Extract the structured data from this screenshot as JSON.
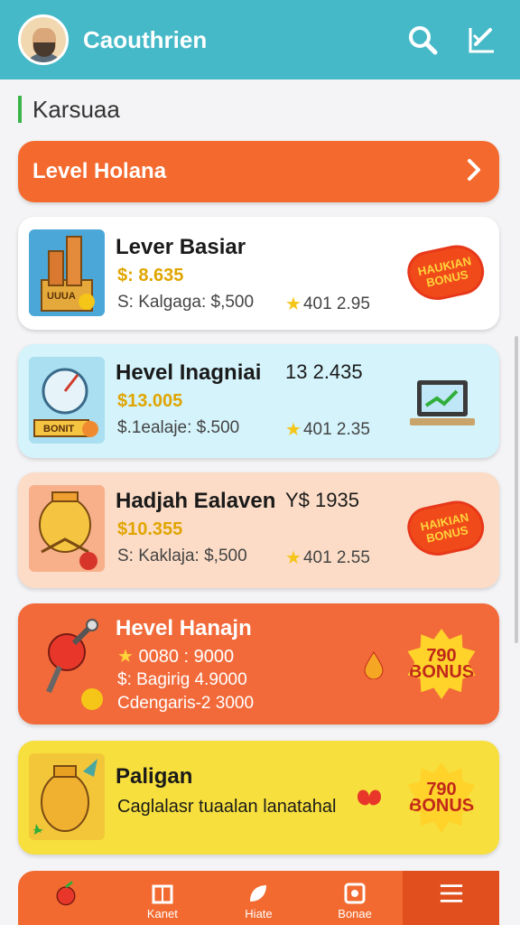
{
  "header": {
    "app_title": "Caouthrien"
  },
  "section": {
    "label": "Karsuaa"
  },
  "level_banner": {
    "label": "Level Holana"
  },
  "cards": [
    {
      "title": "Lever Basiar",
      "title_extra": "",
      "price": "$: 8.635",
      "sub": "S: Kalgaga: $,500",
      "rating": "401 2.95",
      "thumb_caption": "UUUA",
      "badge": "HAUKIAN BONUS",
      "bg": "#ffffff"
    },
    {
      "title": "Hevel Inagniai",
      "title_extra": "13 2.435",
      "price": "$13.005",
      "sub": "$.1ealaje: $.500",
      "rating": "401 2.35",
      "thumb_caption": "BONIT",
      "badge": "",
      "bg": "#d4f3fb"
    },
    {
      "title": "Hadjah Ealaven",
      "title_extra": "Y$ 1935",
      "price": "$10.355",
      "sub": "S: Kaklaja: $,500",
      "rating": "401 2.55",
      "thumb_caption": "",
      "badge": "HAIKIAN BONUS",
      "bg": "#fcdcc6"
    },
    {
      "title": "Hevel Hanajn",
      "title_extra": "",
      "price": "0080 : 9000",
      "sub": "$: Bagirig 4.9000",
      "sub2": "Cdengaris-2 3000",
      "rating": "",
      "thumb_caption": "",
      "badge": "790 BONUS",
      "bg": "#f26a3a"
    },
    {
      "title": "Paligan",
      "title_extra": "",
      "price": "",
      "sub": "Caglalasr tuaalan lanatahal",
      "rating": "",
      "thumb_caption": "",
      "badge": "790 BONUS",
      "bg": "#f7df3d"
    }
  ],
  "bottom_nav": {
    "items": [
      {
        "label": "",
        "icon": "apple-icon"
      },
      {
        "label": "Kanet",
        "icon": "box-icon"
      },
      {
        "label": "Hiate",
        "icon": "leaf-icon"
      },
      {
        "label": "Bonae",
        "icon": "square-icon"
      },
      {
        "label": "",
        "icon": "menu-icon"
      }
    ]
  },
  "icons": {
    "search": "search-icon",
    "edit": "edit-icon",
    "chevron": "chevron-right-icon"
  },
  "colors": {
    "header": "#46b9c8",
    "accent": "#f46a2e",
    "green_marker": "#3ab54a"
  }
}
